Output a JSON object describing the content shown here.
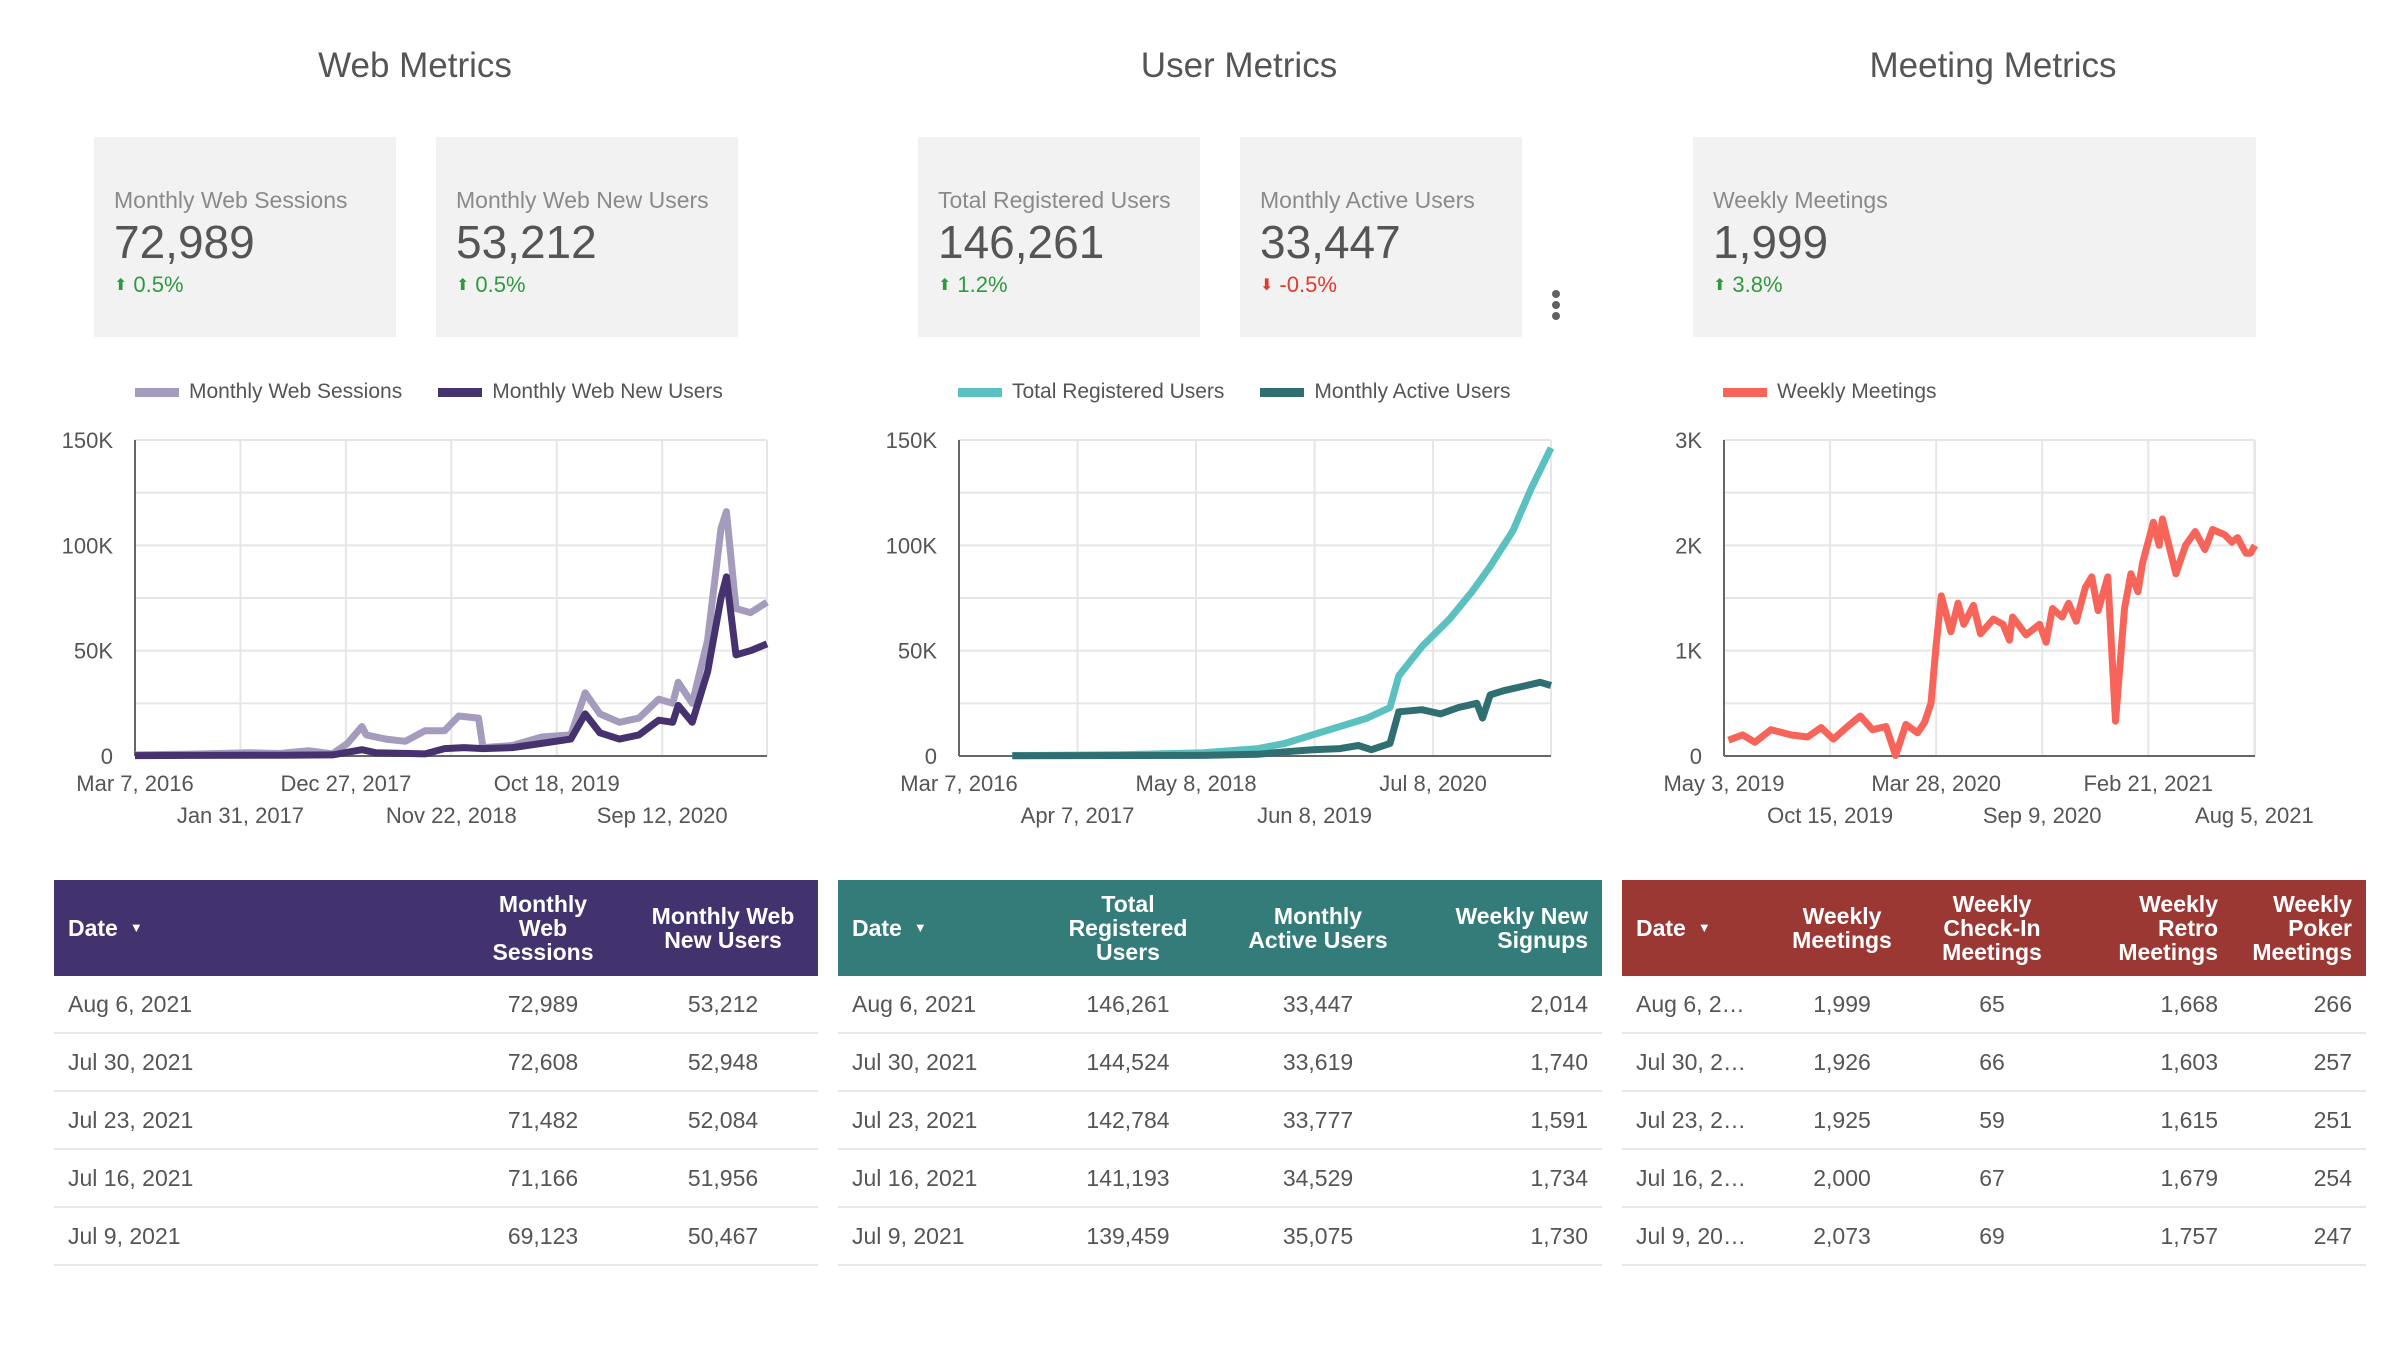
{
  "sections": [
    {
      "title": "Web Metrics"
    },
    {
      "title": "User Metrics"
    },
    {
      "title": "Meeting Metrics"
    }
  ],
  "kpis": [
    {
      "label": "Monthly Web Sessions",
      "value": "72,989",
      "delta": "0.5%",
      "direction": "up"
    },
    {
      "label": "Monthly Web New Users",
      "value": "53,212",
      "delta": "0.5%",
      "direction": "up"
    },
    {
      "label": "Total Registered Users",
      "value": "146,261",
      "delta": "1.2%",
      "direction": "up"
    },
    {
      "label": "Monthly Active Users",
      "value": "33,447",
      "delta": "-0.5%",
      "direction": "down"
    },
    {
      "label": "Weekly Meetings",
      "value": "1,999",
      "delta": "3.8%",
      "direction": "up"
    }
  ],
  "icons": {
    "up": "arrow-up-icon",
    "down": "arrow-down-icon",
    "menu": "more-vert-icon",
    "sort": "sort-desc-icon"
  },
  "glyphs": {
    "up": "⬆",
    "down": "⬇",
    "sort": "▼"
  },
  "colors": {
    "web_sessions": "#a59bbd",
    "web_new_users": "#46326f",
    "total_registered": "#5bc0c0",
    "monthly_active": "#2f6f72",
    "weekly_meetings": "#f7645a",
    "web_table_header": "#42326e",
    "user_table_header": "#337c79",
    "meeting_table_header": "#9b3833",
    "up": "#2e9a3e",
    "down": "#e8372c"
  },
  "chart_data": [
    {
      "type": "line",
      "title": "",
      "xlabel": "",
      "ylabel": "",
      "x_range": [
        "2016-03-07",
        "2021-08-06"
      ],
      "ylim": [
        0,
        150000
      ],
      "y_ticks": [
        0,
        50000,
        100000,
        150000
      ],
      "y_tick_labels": [
        "0",
        "50K",
        "100K",
        "150K"
      ],
      "y_gridlines": [
        0,
        25000,
        50000,
        75000,
        100000,
        125000,
        150000
      ],
      "x_ticks": [
        "2016-03-07",
        "2017-01-31",
        "2017-12-27",
        "2018-11-22",
        "2019-10-18",
        "2020-09-12"
      ],
      "x_tick_labels": [
        "Mar 7, 2016",
        "Jan 31, 2017",
        "Dec 27, 2017",
        "Nov 22, 2018",
        "Oct 18, 2019",
        "Sep 12, 2020"
      ],
      "grid": true,
      "legend": "top-left",
      "series": [
        {
          "name": "Monthly Web Sessions",
          "color_key": "web_sessions",
          "points": [
            [
              "2016-03-07",
              500
            ],
            [
              "2016-09-01",
              900
            ],
            [
              "2017-03-01",
              1500
            ],
            [
              "2017-06-01",
              1200
            ],
            [
              "2017-09-01",
              2500
            ],
            [
              "2017-11-15",
              1000
            ],
            [
              "2018-01-01",
              6000
            ],
            [
              "2018-02-15",
              14000
            ],
            [
              "2018-03-01",
              10000
            ],
            [
              "2018-05-01",
              8000
            ],
            [
              "2018-07-01",
              7000
            ],
            [
              "2018-09-01",
              12000
            ],
            [
              "2018-11-01",
              12000
            ],
            [
              "2018-12-15",
              19000
            ],
            [
              "2019-02-15",
              18000
            ],
            [
              "2019-03-01",
              4000
            ],
            [
              "2019-06-01",
              5000
            ],
            [
              "2019-09-01",
              9000
            ],
            [
              "2019-12-01",
              10000
            ],
            [
              "2020-01-15",
              30000
            ],
            [
              "2020-03-01",
              20000
            ],
            [
              "2020-05-01",
              16000
            ],
            [
              "2020-07-01",
              18000
            ],
            [
              "2020-09-01",
              27000
            ],
            [
              "2020-10-15",
              25000
            ],
            [
              "2020-11-01",
              35000
            ],
            [
              "2020-12-15",
              25000
            ],
            [
              "2021-02-01",
              55000
            ],
            [
              "2021-03-15",
              108000
            ],
            [
              "2021-04-01",
              116000
            ],
            [
              "2021-05-01",
              70000
            ],
            [
              "2021-06-15",
              68000
            ],
            [
              "2021-08-06",
              72989
            ]
          ]
        },
        {
          "name": "Monthly Web New Users",
          "color_key": "web_new_users",
          "points": [
            [
              "2016-03-07",
              200
            ],
            [
              "2016-09-01",
              300
            ],
            [
              "2017-06-01",
              400
            ],
            [
              "2017-11-15",
              500
            ],
            [
              "2018-02-15",
              3000
            ],
            [
              "2018-04-01",
              1500
            ],
            [
              "2018-09-01",
              1000
            ],
            [
              "2018-11-01",
              3500
            ],
            [
              "2019-01-01",
              4000
            ],
            [
              "2019-03-01",
              3500
            ],
            [
              "2019-06-01",
              4000
            ],
            [
              "2019-09-01",
              6000
            ],
            [
              "2019-12-01",
              8000
            ],
            [
              "2020-01-15",
              20000
            ],
            [
              "2020-03-01",
              11000
            ],
            [
              "2020-05-01",
              8000
            ],
            [
              "2020-07-01",
              10000
            ],
            [
              "2020-09-01",
              17000
            ],
            [
              "2020-10-15",
              16000
            ],
            [
              "2020-11-01",
              24000
            ],
            [
              "2020-12-15",
              16000
            ],
            [
              "2021-02-01",
              40000
            ],
            [
              "2021-03-15",
              75000
            ],
            [
              "2021-04-01",
              85000
            ],
            [
              "2021-05-01",
              48000
            ],
            [
              "2021-06-15",
              50000
            ],
            [
              "2021-08-06",
              53212
            ]
          ]
        }
      ]
    },
    {
      "type": "line",
      "title": "",
      "xlabel": "",
      "ylabel": "",
      "x_range": [
        "2016-03-07",
        "2021-08-06"
      ],
      "ylim": [
        0,
        150000
      ],
      "y_ticks": [
        0,
        50000,
        100000,
        150000
      ],
      "y_tick_labels": [
        "0",
        "50K",
        "100K",
        "150K"
      ],
      "y_gridlines": [
        0,
        25000,
        50000,
        75000,
        100000,
        125000,
        150000
      ],
      "x_ticks": [
        "2016-03-07",
        "2017-04-07",
        "2018-05-08",
        "2019-06-08",
        "2020-07-08"
      ],
      "x_tick_labels": [
        "Mar 7, 2016",
        "Apr 7, 2017",
        "May 8, 2018",
        "Jun 8, 2019",
        "Jul 8, 2020"
      ],
      "grid": true,
      "legend": "top-left",
      "series": [
        {
          "name": "Total Registered Users",
          "color_key": "total_registered",
          "points": [
            [
              "2016-09-01",
              200
            ],
            [
              "2017-09-01",
              600
            ],
            [
              "2018-06-01",
              1500
            ],
            [
              "2018-12-01",
              3500
            ],
            [
              "2019-03-01",
              6000
            ],
            [
              "2019-06-01",
              10000
            ],
            [
              "2019-09-01",
              14000
            ],
            [
              "2019-12-01",
              18000
            ],
            [
              "2020-02-15",
              23000
            ],
            [
              "2020-03-15",
              38000
            ],
            [
              "2020-06-01",
              52000
            ],
            [
              "2020-09-01",
              65000
            ],
            [
              "2020-11-15",
              78000
            ],
            [
              "2021-01-15",
              90000
            ],
            [
              "2021-04-01",
              107000
            ],
            [
              "2021-06-01",
              127000
            ],
            [
              "2021-08-06",
              146261
            ]
          ]
        },
        {
          "name": "Monthly Active Users",
          "color_key": "monthly_active",
          "points": [
            [
              "2016-09-01",
              100
            ],
            [
              "2018-06-01",
              300
            ],
            [
              "2018-12-01",
              800
            ],
            [
              "2019-03-01",
              2000
            ],
            [
              "2019-06-01",
              3000
            ],
            [
              "2019-09-01",
              3500
            ],
            [
              "2019-11-01",
              5000
            ],
            [
              "2019-12-15",
              3000
            ],
            [
              "2020-02-15",
              6000
            ],
            [
              "2020-03-15",
              21000
            ],
            [
              "2020-06-01",
              22000
            ],
            [
              "2020-08-01",
              20000
            ],
            [
              "2020-10-01",
              23000
            ],
            [
              "2020-12-01",
              25000
            ],
            [
              "2020-12-20",
              18000
            ],
            [
              "2021-01-15",
              29000
            ],
            [
              "2021-03-01",
              31000
            ],
            [
              "2021-05-01",
              33000
            ],
            [
              "2021-07-01",
              35000
            ],
            [
              "2021-08-06",
              33447
            ]
          ]
        }
      ]
    },
    {
      "type": "line",
      "title": "",
      "xlabel": "",
      "ylabel": "",
      "x_range": [
        "2019-05-03",
        "2021-08-06"
      ],
      "ylim": [
        0,
        3000
      ],
      "y_ticks": [
        0,
        1000,
        2000,
        3000
      ],
      "y_tick_labels": [
        "0",
        "1K",
        "2K",
        "3K"
      ],
      "y_gridlines": [
        0,
        500,
        1000,
        1500,
        2000,
        2500,
        3000
      ],
      "x_ticks": [
        "2019-05-03",
        "2019-10-15",
        "2020-03-28",
        "2020-09-09",
        "2021-02-21",
        "2021-08-05"
      ],
      "x_tick_labels": [
        "May 3, 2019",
        "Oct 15, 2019",
        "Mar 28, 2020",
        "Sep 9, 2020",
        "Feb 21, 2021",
        "Aug 5, 2021"
      ],
      "grid": true,
      "legend": "top-left",
      "series": [
        {
          "name": "Weekly Meetings",
          "color_key": "weekly_meetings",
          "points": [
            [
              "2019-05-10",
              150
            ],
            [
              "2019-06-01",
              200
            ],
            [
              "2019-06-20",
              130
            ],
            [
              "2019-07-15",
              250
            ],
            [
              "2019-08-15",
              200
            ],
            [
              "2019-09-10",
              180
            ],
            [
              "2019-10-01",
              270
            ],
            [
              "2019-10-20",
              160
            ],
            [
              "2019-11-15",
              300
            ],
            [
              "2019-12-01",
              380
            ],
            [
              "2019-12-20",
              250
            ],
            [
              "2020-01-10",
              280
            ],
            [
              "2020-01-25",
              5
            ],
            [
              "2020-02-10",
              300
            ],
            [
              "2020-02-28",
              220
            ],
            [
              "2020-03-10",
              320
            ],
            [
              "2020-03-20",
              500
            ],
            [
              "2020-03-28",
              1050
            ],
            [
              "2020-04-05",
              1520
            ],
            [
              "2020-04-20",
              1180
            ],
            [
              "2020-05-01",
              1450
            ],
            [
              "2020-05-10",
              1250
            ],
            [
              "2020-05-25",
              1430
            ],
            [
              "2020-06-05",
              1160
            ],
            [
              "2020-06-25",
              1300
            ],
            [
              "2020-07-10",
              1250
            ],
            [
              "2020-07-20",
              1100
            ],
            [
              "2020-07-25",
              1320
            ],
            [
              "2020-08-15",
              1150
            ],
            [
              "2020-09-05",
              1250
            ],
            [
              "2020-09-15",
              1080
            ],
            [
              "2020-09-25",
              1400
            ],
            [
              "2020-10-10",
              1320
            ],
            [
              "2020-10-20",
              1450
            ],
            [
              "2020-11-01",
              1280
            ],
            [
              "2020-11-15",
              1600
            ],
            [
              "2020-11-25",
              1700
            ],
            [
              "2020-12-05",
              1380
            ],
            [
              "2020-12-20",
              1700
            ],
            [
              "2021-01-01",
              330
            ],
            [
              "2021-01-15",
              1400
            ],
            [
              "2021-01-25",
              1730
            ],
            [
              "2021-02-05",
              1560
            ],
            [
              "2021-02-12",
              1830
            ],
            [
              "2021-03-01",
              2220
            ],
            [
              "2021-03-10",
              2000
            ],
            [
              "2021-03-15",
              2250
            ],
            [
              "2021-04-05",
              1730
            ],
            [
              "2021-04-20",
              2000
            ],
            [
              "2021-05-05",
              2130
            ],
            [
              "2021-05-20",
              1960
            ],
            [
              "2021-06-01",
              2150
            ],
            [
              "2021-06-20",
              2100
            ],
            [
              "2021-07-01",
              2030
            ],
            [
              "2021-07-10",
              2073
            ],
            [
              "2021-07-16",
              2000
            ],
            [
              "2021-07-23",
              1925
            ],
            [
              "2021-07-30",
              1926
            ],
            [
              "2021-08-06",
              1999
            ]
          ]
        }
      ]
    }
  ],
  "tables": {
    "web": {
      "headers": [
        "Date",
        "Monthly Web Sessions",
        "Monthly Web New Users"
      ],
      "rows": [
        [
          "Aug 6, 2021",
          "72,989",
          "53,212"
        ],
        [
          "Jul 30, 2021",
          "72,608",
          "52,948"
        ],
        [
          "Jul 23, 2021",
          "71,482",
          "52,084"
        ],
        [
          "Jul 16, 2021",
          "71,166",
          "51,956"
        ],
        [
          "Jul 9, 2021",
          "69,123",
          "50,467"
        ]
      ]
    },
    "user": {
      "headers": [
        "Date",
        "Total Registered Users",
        "Monthly Active Users",
        "Weekly New Signups"
      ],
      "rows": [
        [
          "Aug 6, 2021",
          "146,261",
          "33,447",
          "2,014"
        ],
        [
          "Jul 30, 2021",
          "144,524",
          "33,619",
          "1,740"
        ],
        [
          "Jul 23, 2021",
          "142,784",
          "33,777",
          "1,591"
        ],
        [
          "Jul 16, 2021",
          "141,193",
          "34,529",
          "1,734"
        ],
        [
          "Jul 9, 2021",
          "139,459",
          "35,075",
          "1,730"
        ]
      ]
    },
    "meeting": {
      "headers": [
        "Date",
        "Weekly Meetings",
        "Weekly Check-In Meetings",
        "Weekly Retro Meetings",
        "Weekly Poker Meetings"
      ],
      "rows": [
        [
          "Aug 6, 2…",
          "1,999",
          "65",
          "1,668",
          "266"
        ],
        [
          "Jul 30, 2…",
          "1,926",
          "66",
          "1,603",
          "257"
        ],
        [
          "Jul 23, 2…",
          "1,925",
          "59",
          "1,615",
          "251"
        ],
        [
          "Jul 16, 2…",
          "2,000",
          "67",
          "1,679",
          "254"
        ],
        [
          "Jul 9, 20…",
          "2,073",
          "69",
          "1,757",
          "247"
        ]
      ]
    }
  }
}
